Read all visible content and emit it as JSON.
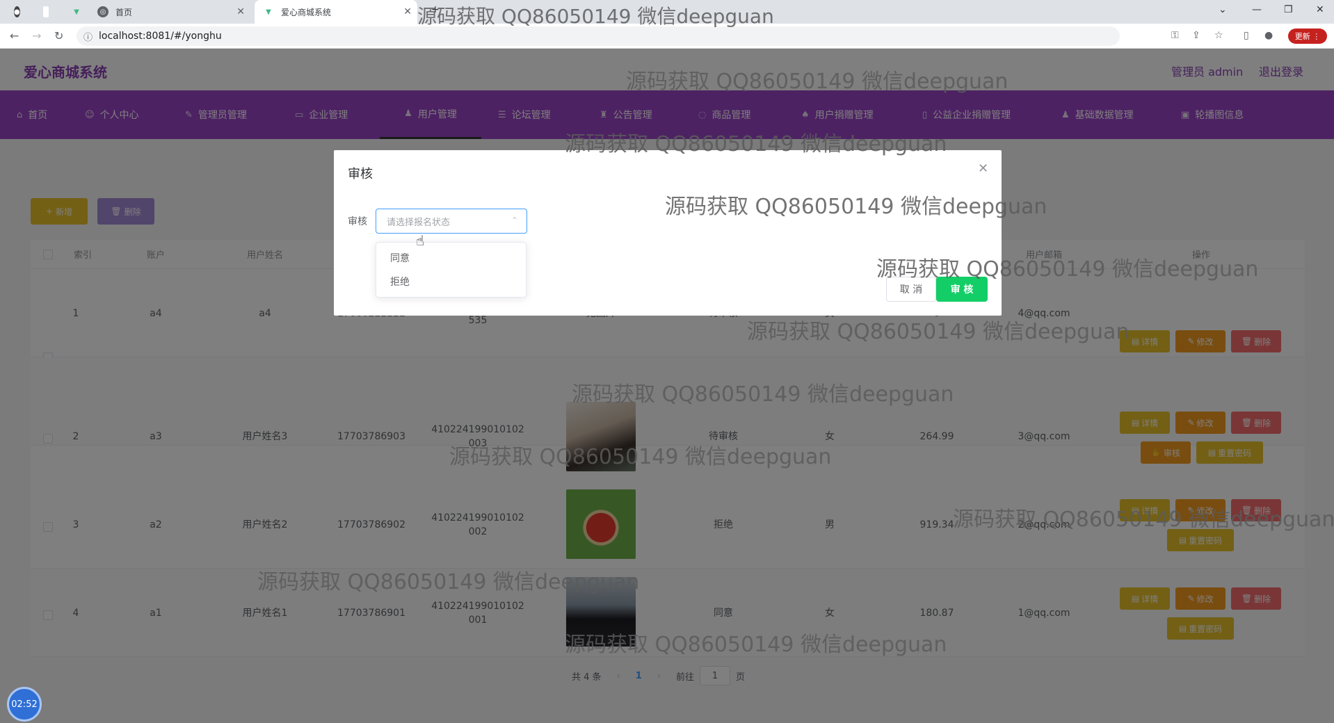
{
  "browser": {
    "tabs": [
      {
        "label": "首页",
        "active": false
      },
      {
        "label": "爱心商城系统",
        "active": true
      }
    ],
    "url": "localhost:8081/#/yonghu",
    "update_label": "更新"
  },
  "header": {
    "title": "爱心商城系统",
    "admin": "管理员 admin",
    "logout": "退出登录"
  },
  "menu": {
    "items": [
      {
        "label": "首页"
      },
      {
        "label": "个人中心"
      },
      {
        "label": "管理员管理"
      },
      {
        "label": "企业管理"
      },
      {
        "label": "用户管理"
      },
      {
        "label": "论坛管理"
      },
      {
        "label": "公告管理"
      },
      {
        "label": "商品管理"
      },
      {
        "label": "用户捐赠管理"
      },
      {
        "label": "公益企业捐赠管理"
      },
      {
        "label": "基础数据管理"
      },
      {
        "label": "轮播图信息"
      }
    ],
    "active_index": 4
  },
  "toolbar": {
    "add_label": "新增",
    "delete_label": "删除"
  },
  "table": {
    "headers": [
      "索引",
      "账户",
      "用户姓名",
      "",
      "",
      "",
      "",
      "",
      "",
      "用户邮箱",
      "操作"
    ],
    "rows": [
      {
        "index": "1",
        "account": "a4",
        "name": "a4",
        "phone": "17666222222",
        "idcard": "410008199502214535",
        "photo": "无图片",
        "status": "待审核",
        "sex": "女",
        "balance": "0",
        "email": "4@qq.com"
      },
      {
        "index": "2",
        "account": "a3",
        "name": "用户姓名3",
        "phone": "17703786903",
        "idcard": "410224199010102003",
        "photo": "",
        "status": "待审核",
        "sex": "女",
        "balance": "264.99",
        "email": "3@qq.com"
      },
      {
        "index": "3",
        "account": "a2",
        "name": "用户姓名2",
        "phone": "17703786902",
        "idcard": "410224199010102002",
        "photo": "",
        "status": "拒绝",
        "sex": "男",
        "balance": "919.34",
        "email": "2@qq.com"
      },
      {
        "index": "4",
        "account": "a1",
        "name": "用户姓名1",
        "phone": "17703786901",
        "idcard": "410224199010102001",
        "photo": "",
        "status": "同意",
        "sex": "女",
        "balance": "180.87",
        "email": "1@qq.com"
      }
    ],
    "actions": {
      "detail": "详情",
      "edit": "修改",
      "delete": "删除",
      "audit": "审核",
      "reset": "重置密码"
    }
  },
  "pager": {
    "total": "共 4 条",
    "current": "1",
    "goto": "前往",
    "page_value": "1",
    "page_unit": "页"
  },
  "dialog": {
    "title": "审核",
    "field_label": "审核",
    "select_placeholder": "请选择报名状态",
    "options": [
      "同意",
      "拒绝"
    ],
    "cancel": "取 消",
    "confirm": "审 核"
  },
  "watermark": "源码获取 QQ86050149 微信deepguan",
  "timer": "02:52"
}
